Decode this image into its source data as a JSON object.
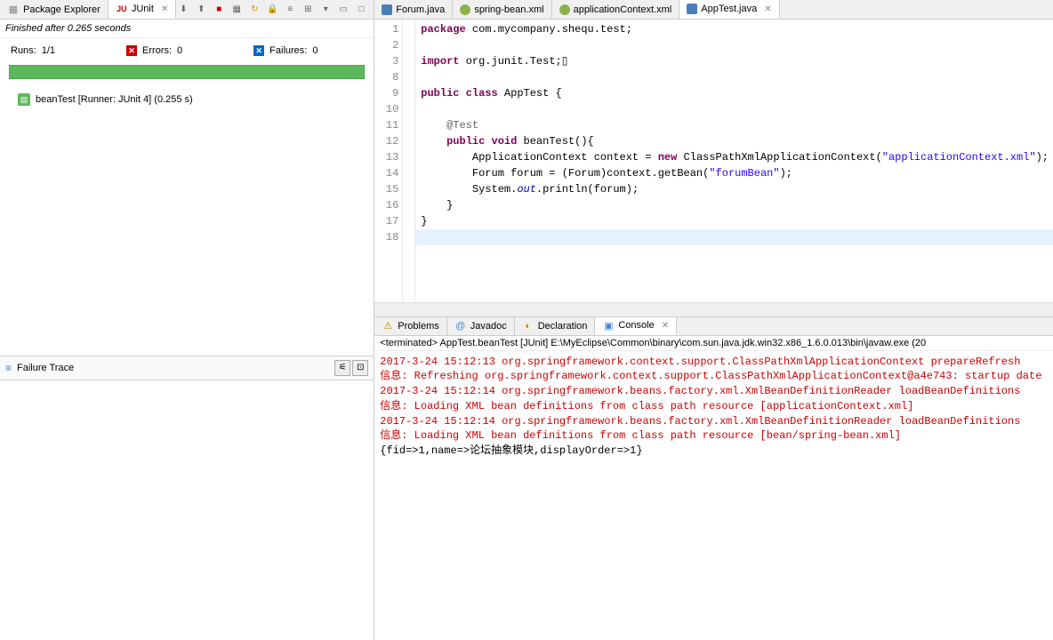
{
  "left": {
    "tabs": {
      "pkg": "Package Explorer",
      "junit": "JUnit"
    },
    "status": "Finished after 0.265 seconds",
    "runs_label": "Runs:",
    "runs_value": "1/1",
    "errors_label": "Errors:",
    "errors_value": "0",
    "failures_label": "Failures:",
    "failures_value": "0",
    "test_item": "beanTest [Runner: JUnit 4] (0.255 s)",
    "failure_trace": "Failure Trace"
  },
  "editor": {
    "tabs": {
      "forum": "Forum.java",
      "spring": "spring-bean.xml",
      "appctx": "applicationContext.xml",
      "apptest": "AppTest.java"
    },
    "lines": [
      "1",
      "2",
      "3",
      "8",
      "9",
      "10",
      "11",
      "12",
      "13",
      "14",
      "15",
      "16",
      "17",
      "18"
    ]
  },
  "bottom": {
    "tabs": {
      "problems": "Problems",
      "javadoc": "Javadoc",
      "decl": "Declaration",
      "console": "Console"
    },
    "header": "<terminated> AppTest.beanTest [JUnit] E:\\MyEclipse\\Common\\binary\\com.sun.java.jdk.win32.x86_1.6.0.013\\bin\\javaw.exe (20",
    "lines": [
      {
        "cls": "log-red",
        "txt": "2017-3-24 15:12:13 org.springframework.context.support.ClassPathXmlApplicationContext prepareRefresh"
      },
      {
        "cls": "log-red",
        "txt": "信息: Refreshing org.springframework.context.support.ClassPathXmlApplicationContext@a4e743: startup date"
      },
      {
        "cls": "log-red",
        "txt": "2017-3-24 15:12:14 org.springframework.beans.factory.xml.XmlBeanDefinitionReader loadBeanDefinitions"
      },
      {
        "cls": "log-red",
        "txt": "信息: Loading XML bean definitions from class path resource [applicationContext.xml]"
      },
      {
        "cls": "log-red",
        "txt": "2017-3-24 15:12:14 org.springframework.beans.factory.xml.XmlBeanDefinitionReader loadBeanDefinitions"
      },
      {
        "cls": "log-red",
        "txt": "信息: Loading XML bean definitions from class path resource [bean/spring-bean.xml]"
      },
      {
        "cls": "",
        "txt": "{fid=>1,name=>论坛抽象模块,displayOrder=>1}"
      }
    ]
  }
}
